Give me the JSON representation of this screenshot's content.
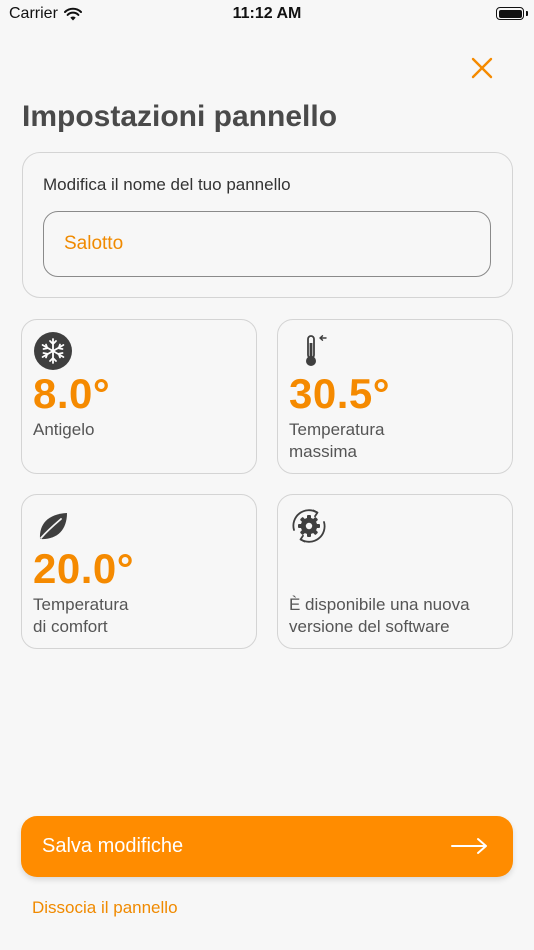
{
  "status_bar": {
    "carrier": "Carrier",
    "time": "11:12 AM"
  },
  "header": {
    "title": "Impostazioni pannello",
    "close_icon": "close-icon"
  },
  "name_section": {
    "label": "Modifica il nome del tuo pannello",
    "value": "Salotto"
  },
  "tiles": [
    {
      "icon": "snowflake-icon",
      "value": "8.0°",
      "label": "Antigelo"
    },
    {
      "icon": "thermometer-icon",
      "value": "30.5°",
      "label_line1": "Temperatura",
      "label_line2": "massima"
    },
    {
      "icon": "leaf-icon",
      "value": "20.0°",
      "label_line1": "Temperatura",
      "label_line2": "di comfort"
    },
    {
      "icon": "gear-update-icon",
      "label_line1": "È disponibile una nuova",
      "label_line2": "versione del software"
    }
  ],
  "footer": {
    "save_label": "Salva modifiche",
    "dissociate_label": "Dissocia il pannello"
  },
  "colors": {
    "accent": "#ff8c00",
    "accent_text": "#f58a00",
    "background": "#f7f7f7",
    "border": "#d4d4d4"
  }
}
